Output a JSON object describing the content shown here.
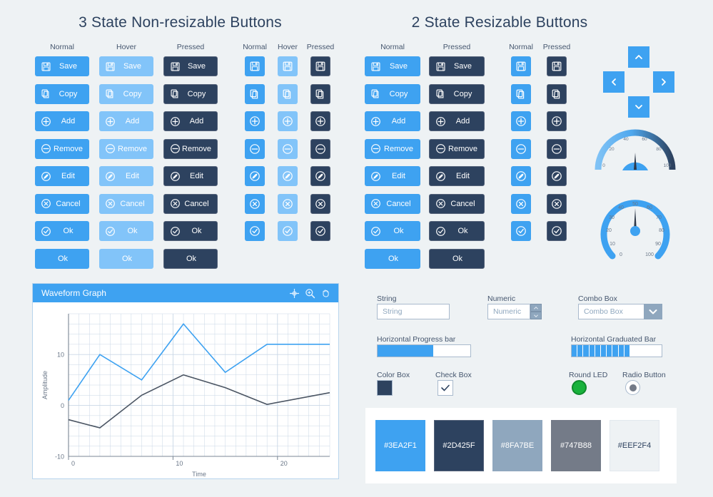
{
  "sections": {
    "left_title": "3 State Non-resizable Buttons",
    "right_title": "2 State Resizable Buttons"
  },
  "left_panel": {
    "labeled_states": [
      "Normal",
      "Hover",
      "Pressed"
    ],
    "icon_states": [
      "Normal",
      "Hover",
      "Pressed"
    ],
    "rows": [
      {
        "label": "Save",
        "icon": "floppy-disk-icon"
      },
      {
        "label": "Copy",
        "icon": "copy-pages-icon"
      },
      {
        "label": "Add",
        "icon": "plus-circle-icon"
      },
      {
        "label": "Remove",
        "icon": "minus-circle-icon"
      },
      {
        "label": "Edit",
        "icon": "pencil-circle-icon"
      },
      {
        "label": "Cancel",
        "icon": "x-circle-icon"
      },
      {
        "label": "Ok",
        "icon": "check-circle-icon"
      }
    ],
    "text_only_row": {
      "label": "Ok"
    }
  },
  "right_panel": {
    "labeled_states": [
      "Normal",
      "Pressed"
    ],
    "icon_states": [
      "Normal",
      "Pressed"
    ],
    "rows": [
      {
        "label": "Save",
        "icon": "floppy-disk-icon"
      },
      {
        "label": "Copy",
        "icon": "copy-pages-icon"
      },
      {
        "label": "Add",
        "icon": "plus-circle-icon"
      },
      {
        "label": "Remove",
        "icon": "minus-circle-icon"
      },
      {
        "label": "Edit",
        "icon": "pencil-circle-icon"
      },
      {
        "label": "Cancel",
        "icon": "x-circle-icon"
      },
      {
        "label": "Ok",
        "icon": "check-circle-icon"
      }
    ],
    "text_only_row": {
      "label": "Ok"
    }
  },
  "arrow_pad": {
    "up": "chevron-up-icon",
    "down": "chevron-down-icon",
    "left": "chevron-left-icon",
    "right": "chevron-right-icon"
  },
  "gauges": [
    {
      "name": "semicircular-gauge",
      "min": 0,
      "max": 100,
      "value": 50,
      "ticks": [
        "0",
        "20",
        "40",
        "60",
        "80",
        "100"
      ]
    },
    {
      "name": "round-gauge",
      "min": 0,
      "max": 100,
      "value": 50,
      "ticks": [
        "0",
        "10",
        "20",
        "30",
        "40",
        "50",
        "60",
        "70",
        "80",
        "90",
        "100"
      ]
    }
  ],
  "graph": {
    "title": "Waveform Graph",
    "toolbar": [
      "crosshair-cursor-icon",
      "zoom-magnifier-icon",
      "pan-hand-icon"
    ]
  },
  "chart_data": {
    "type": "line",
    "title": "Waveform Graph",
    "xlabel": "Time",
    "ylabel": "Amplitude",
    "xlim": [
      0,
      25
    ],
    "ylim": [
      -10,
      18
    ],
    "xticks": [
      0,
      10,
      20
    ],
    "yticks": [
      -10,
      0,
      10
    ],
    "grid": true,
    "legend": "none",
    "series": [
      {
        "name": "signal-blue",
        "color": "#3EA2F1",
        "x": [
          0,
          3,
          7,
          11,
          15,
          19,
          25
        ],
        "y": [
          1,
          10,
          5,
          16,
          6.5,
          12,
          12
        ]
      },
      {
        "name": "signal-dark",
        "color": "#4B5563",
        "x": [
          0,
          3,
          7,
          11,
          15,
          19,
          25
        ],
        "y": [
          -2.8,
          -4.4,
          2,
          6,
          3.5,
          0.2,
          2.5
        ]
      }
    ]
  },
  "controls": {
    "string": {
      "label": "String",
      "value": "String"
    },
    "numeric": {
      "label": "Numeric",
      "value": "Numeric",
      "up": "spinner-up-icon",
      "down": "spinner-down-icon"
    },
    "combo": {
      "label": "Combo Box",
      "value": "Combo Box",
      "arrow": "chevron-down-icon"
    },
    "progress": {
      "label": "Horizontal Progress bar",
      "percent": 60
    },
    "graduated": {
      "label": "Horizontal Graduated Bar",
      "percent": 65,
      "segments": 10
    },
    "color_box": {
      "label": "Color Box",
      "value": "#2D425F"
    },
    "check_box": {
      "label": "Check Box",
      "checked": true,
      "icon": "checkmark-icon"
    },
    "round_led": {
      "label": "Round LED",
      "color": "#19B23C",
      "on": true
    },
    "radio": {
      "label": "Radio Button",
      "selected": true
    }
  },
  "palette": [
    {
      "hex": "#3EA2F1",
      "text": "#3EA2F1",
      "textcolor": "#ffffff"
    },
    {
      "hex": "#2D425F",
      "text": "#2D425F",
      "textcolor": "#ffffff"
    },
    {
      "hex": "#8FA7BE",
      "text": "#8FA7BE",
      "textcolor": "#ffffff"
    },
    {
      "hex": "#747B88",
      "text": "#747B88",
      "textcolor": "#ffffff"
    },
    {
      "hex": "#EEF2F4",
      "text": "#EEF2F4",
      "textcolor": "#2D425F"
    }
  ]
}
